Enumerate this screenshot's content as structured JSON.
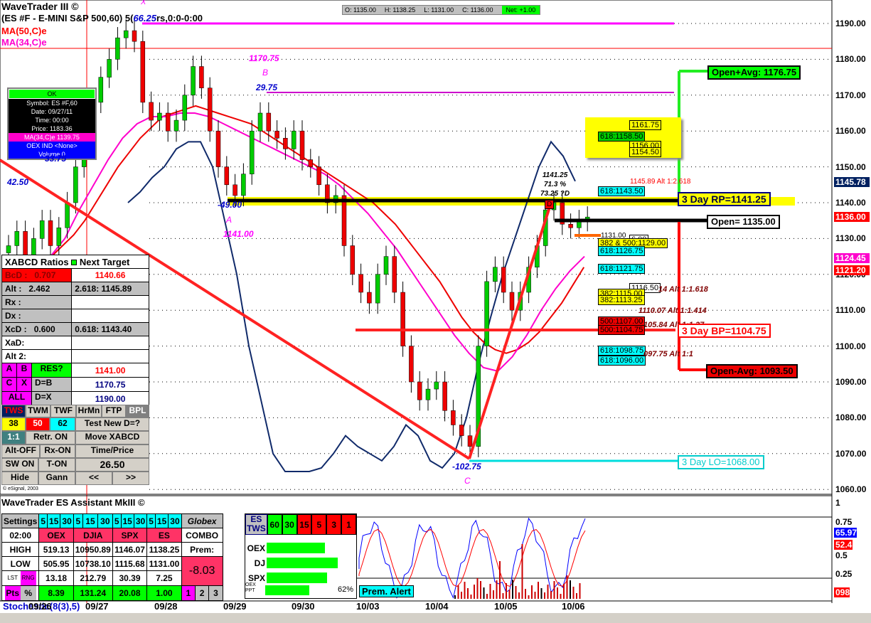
{
  "header": {
    "title": "WaveTrader III ©",
    "symbol_line": "(ES #F - E-MINI S&P 500,60) 5(",
    "symbol_line_tail": "rs,0:0-0:00",
    "ma50": "MA(50,C)e",
    "ma34": "MA(34,C)e"
  },
  "ohlc_bar": {
    "open": "O: 1135.00",
    "high": "H: 1138.25",
    "low": "L: 1131.00",
    "close": "C: 1136.00",
    "net": "Net: +1.00"
  },
  "tooltip": {
    "ok": "OK",
    "symbol": "Symbol: ES #F,60",
    "date": "Date: 09/27/11",
    "time": "Time: 00:00",
    "price": "Price: 1183.36",
    "ma": "MA(34,C)e 1139.75",
    "oex": "OEX IND <None>",
    "volume": "Volume 0"
  },
  "price_axis": [
    "1190.00",
    "1180.00",
    "1170.00",
    "1160.00",
    "1150.00",
    "1140.00",
    "1130.00",
    "1120.00",
    "1110.00",
    "1100.00",
    "1090.00",
    "1080.00",
    "1070.00",
    "1060.00"
  ],
  "price_tags": [
    {
      "text": "1145.78",
      "color": "#002060"
    },
    {
      "text": "1136.00",
      "color": "#ff0000"
    },
    {
      "text": "1124.45",
      "color": "#ff00cc"
    },
    {
      "text": "1121.20",
      "color": "#ff0000"
    }
  ],
  "osc_axis": [
    "1",
    "0.75",
    "0.5",
    "0.25"
  ],
  "osc_tags": {
    "blue": "65.97",
    "red": "52.4",
    "bottom": "098"
  },
  "date_axis": [
    "09/26",
    "09/27",
    "09/28",
    "09/29",
    "09/30",
    "10/03",
    "10/04",
    "10/05",
    "10/06"
  ],
  "stochastic_label": "Stochastic(8(3),5)",
  "pattern_labels": {
    "x": "X",
    "x_val": "66.25",
    "b_price": "1170.75",
    "b": "B",
    "b_val": "29.75",
    "v1": "42.50",
    "v2": "33.75",
    "a_val": "-49.00",
    "a": "A",
    "a_price": "1141.00",
    "c_val": "-102.75",
    "c": "C",
    "d_price": "1141.25",
    "d_pct": "71.3 %",
    "d_pts": "73.25 ?D",
    "d": "D",
    "low_label": "1131.00"
  },
  "levels": {
    "open_plus": "Open+Avg: 1176.75",
    "rp": "3 Day RP=1141.25",
    "open": "Open= 1135.00",
    "bp": "3 Day BP=1104.75",
    "open_minus": "Open-Avg: 1093.50",
    "lo": "3 Day LO=1068.00"
  },
  "fib_labels": {
    "y1": "1161.75",
    "g1": "618:1158.50",
    "y2": "1156.00",
    "y3": "1154.50",
    "alt2618": "1145.89 Alt 1:2.618",
    "c1": "618:1143.50",
    "y4": "382 & 500:1129.00",
    "c2": "618:1126.75",
    "w1": "6.00",
    "c3": "618:1121.75",
    "w2": "1116.50",
    "alt1618": "14 Alt 1:1.618",
    "y5": "382:1115.00",
    "y6": "382:1113.25",
    "alt1414": "1110.07 Alt 1:1.414",
    "r1": "500:1107.00",
    "r2": "500:1104.75",
    "alt1x": "105.84 Alt 1:1.27",
    "c4": "618:1098.75",
    "c5": "618:1096.00",
    "alt11": "097.75 Alt 1:1"
  },
  "xabcd": {
    "title": "XABCD Ratios",
    "next": "Next Target",
    "rows": [
      [
        "BcD :",
        "0.707",
        "1140.66"
      ],
      [
        "Alt  :",
        "2.462",
        "2.618: 1145.89"
      ],
      [
        "Rx  :",
        "",
        ""
      ],
      [
        "Dx  :",
        "",
        ""
      ],
      [
        "XcD :",
        "0.600",
        "0.618: 1143.40"
      ],
      [
        "XaD:",
        "",
        ""
      ],
      [
        "Alt 2:",
        "",
        ""
      ]
    ],
    "a": "A",
    "b": "B",
    "res": "RES?",
    "res_val": "1141.00",
    "c": "C",
    "x": "X",
    "db": "D=B",
    "db_val": "1170.75",
    "all": "ALL",
    "dx": "D=X",
    "dx_val": "1190.00",
    "buttons": [
      "TWS",
      "TWM",
      "TWF",
      "HrMn",
      "FTP",
      "BPL"
    ],
    "f38": "38",
    "f50": "50",
    "f62": "62",
    "test": "Test New D=?",
    "one": "1:1",
    "retr": "Retr. ON",
    "move": "Move XABCD",
    "alt": "Alt-OFF",
    "rx": "Rx-ON",
    "tp": "Time/Price",
    "sw": "SW ON",
    "t": "T-ON",
    "val": "26.50",
    "hide": "Hide",
    "gann": "Gann",
    "prev": "<<",
    "next_btn": ">>"
  },
  "copyright": "© eSignal, 2003",
  "assistant": {
    "title": "WaveTrader ES Assistant MkIII ©",
    "settings": "Settings",
    "tf": [
      "5",
      "15",
      "30"
    ],
    "globex": "Globex",
    "time": "02:00",
    "cols": [
      "OEX",
      "DJIA",
      "SPX",
      "ES"
    ],
    "combo": "COMBO",
    "high": [
      "HIGH",
      "519.13",
      "10950.89",
      "1146.07",
      "1138.25"
    ],
    "prem": "Prem:",
    "low": [
      "LOW",
      "505.95",
      "10738.10",
      "1115.68",
      "1131.00"
    ],
    "prem_val": "-8.03",
    "lst": "LST",
    "rng": "RNG",
    "rng_vals": [
      "13.18",
      "212.79",
      "30.39",
      "7.25"
    ],
    "pts": "Pts",
    "pct": "%",
    "pts_vals": [
      "8.39",
      "131.24",
      "20.08",
      "1.00"
    ],
    "pages": [
      "1",
      "2",
      "3"
    ],
    "es_tws": "ES TWS",
    "tws_tf": [
      "60",
      "30",
      "15",
      "5",
      "3",
      "1"
    ],
    "bars": [
      {
        "name": "OEX",
        "fill": 0.68
      },
      {
        "name": "DJ",
        "fill": 0.83
      },
      {
        "name": "SPX",
        "fill": 0.71
      }
    ],
    "ppt": "OEX PPT",
    "ppt_fill": 0.56,
    "ppt_pct": "62%",
    "alert": "Prem. Alert"
  },
  "chart_data": {
    "type": "candlestick",
    "closes": [
      1128,
      1132,
      1125,
      1130,
      1135,
      1128,
      1133,
      1140,
      1150,
      1160,
      1168,
      1175,
      1180,
      1186,
      1188,
      1185,
      1168,
      1163,
      1165,
      1160,
      1163,
      1170,
      1178,
      1172,
      1160,
      1150,
      1145,
      1142,
      1148,
      1160,
      1165,
      1160,
      1158,
      1155,
      1160,
      1152,
      1150,
      1145,
      1140,
      1142,
      1128,
      1120,
      1115,
      1112,
      1120,
      1125,
      1115,
      1100,
      1090,
      1085,
      1088,
      1090,
      1082,
      1078,
      1075,
      1072,
      1100,
      1118,
      1122,
      1115,
      1110,
      1115,
      1122,
      1128,
      1138,
      1140,
      1134,
      1133,
      1135,
      1136
    ],
    "ma50": [
      1120,
      1121,
      1122,
      1123,
      1125,
      1128,
      1131,
      1135,
      1140,
      1145,
      1150,
      1154,
      1158,
      1161,
      1164,
      1165,
      1166,
      1167,
      1166,
      1165,
      1164,
      1163,
      1162,
      1160,
      1158,
      1156,
      1154,
      1152,
      1150,
      1148,
      1146,
      1144,
      1142,
      1140,
      1137,
      1134,
      1130,
      1126,
      1122,
      1118,
      1113,
      1108,
      1104,
      1101,
      1099,
      1098,
      1099,
      1101,
      1104,
      1108,
      1112,
      1117,
      1122
    ],
    "ma34": [
      1118,
      1120,
      1122,
      1125,
      1130,
      1138,
      1145,
      1152,
      1158,
      1162,
      1164,
      1164,
      1165,
      1165,
      1164,
      1162,
      1160,
      1158,
      1156,
      1154,
      1152,
      1150,
      1148,
      1145,
      1141,
      1137,
      1132,
      1127,
      1121,
      1115,
      1109,
      1103,
      1098,
      1094,
      1093,
      1097,
      1103,
      1110,
      1116,
      1121,
      1125
    ],
    "blue_line": [
      1140,
      1143,
      1147,
      1150,
      1155,
      1157,
      1157,
      1150,
      1135,
      1120,
      1100,
      1085,
      1070,
      1065,
      1065,
      1065,
      1066,
      1070,
      1075,
      1072,
      1070,
      1068,
      1072,
      1078,
      1075,
      1068,
      1066,
      1070,
      1080,
      1095,
      1108,
      1120,
      1130,
      1140,
      1150,
      1157,
      1153,
      1146
    ]
  }
}
